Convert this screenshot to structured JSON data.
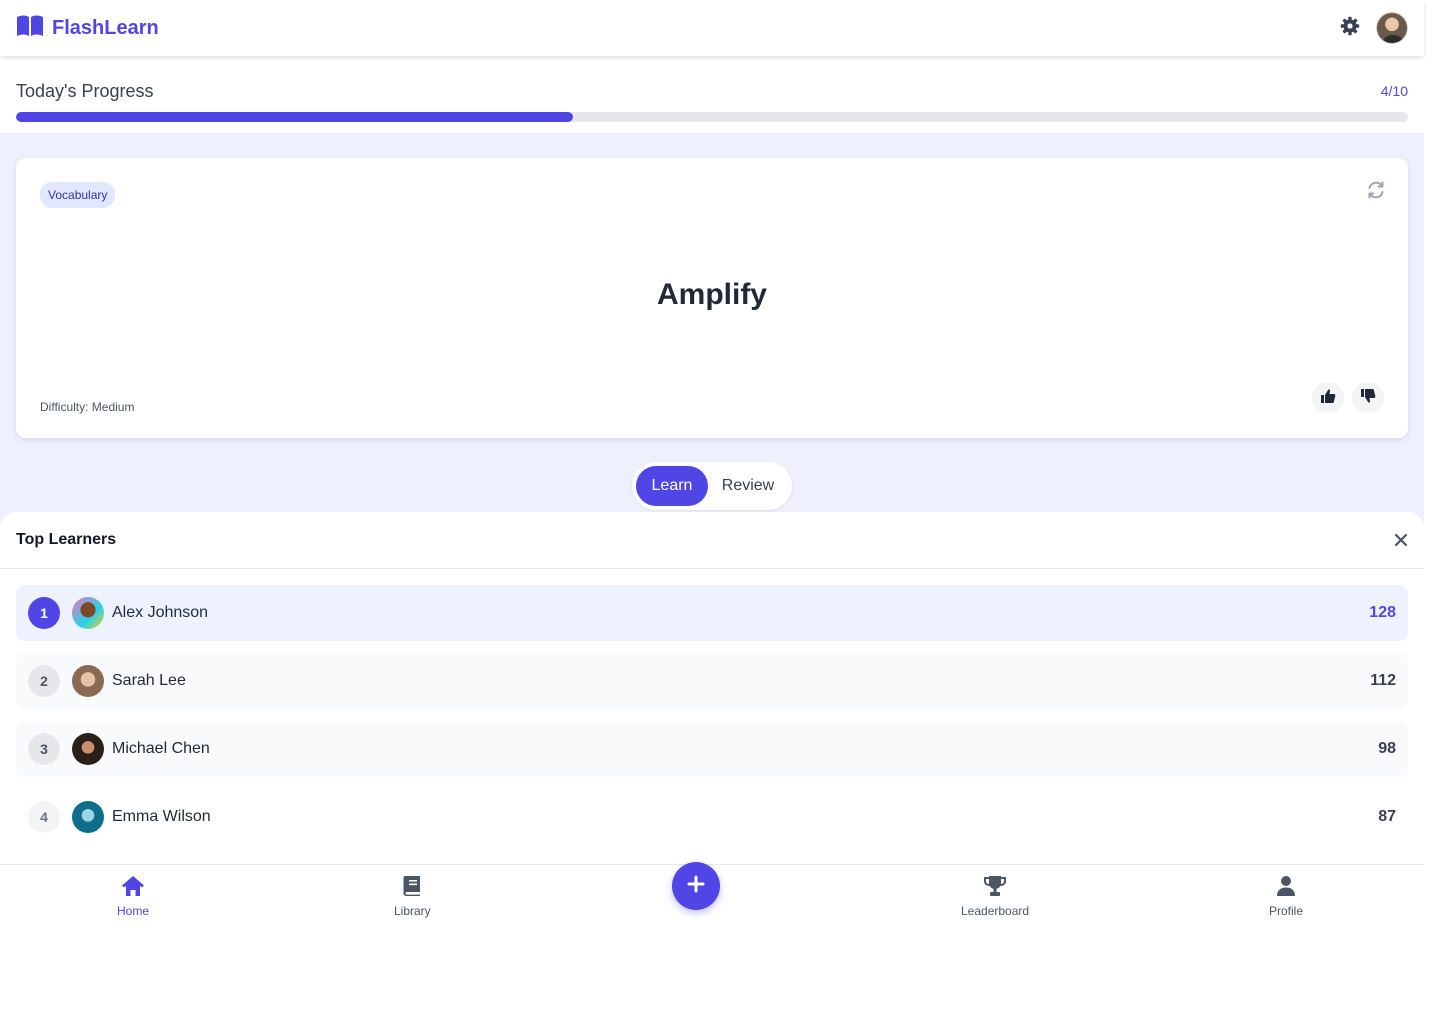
{
  "app": {
    "name": "FlashLearn"
  },
  "icons": {
    "logo": "book-open-icon",
    "settings": "gear-icon",
    "refresh": "refresh-icon",
    "like": "thumbs-up-icon",
    "dislike": "thumbs-down-icon",
    "close": "close-icon"
  },
  "colors": {
    "accent": "#4f46e5",
    "progress_track": "#e5e7eb",
    "main_bg": "#eef0fd"
  },
  "progress": {
    "title": "Today's Progress",
    "count": "4/10",
    "completed": 4,
    "total": 10
  },
  "card": {
    "tag": "Vocabulary",
    "word": "Amplify",
    "difficulty": "Difficulty: Medium"
  },
  "mode": {
    "learn": "Learn",
    "review": "Review",
    "selected": "Learn"
  },
  "leaderboard": {
    "title": "Top Learners",
    "rows": [
      {
        "rank": "1",
        "name": "Alex Johnson",
        "score": "128"
      },
      {
        "rank": "2",
        "name": "Sarah Lee",
        "score": "112"
      },
      {
        "rank": "3",
        "name": "Michael Chen",
        "score": "98"
      },
      {
        "rank": "4",
        "name": "Emma Wilson",
        "score": "87"
      }
    ]
  },
  "nav": {
    "home": "Home",
    "library": "Library",
    "leaderboard": "Leaderboard",
    "profile": "Profile",
    "active": "Home"
  }
}
